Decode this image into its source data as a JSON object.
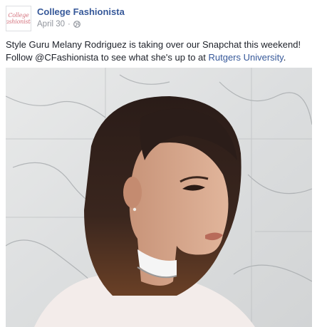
{
  "post": {
    "page_name": "College Fashionista",
    "avatar_logo_text": "College fashionista",
    "date": "April 30",
    "separator": "·",
    "privacy_icon": "globe-icon",
    "text_line1": "Style Guru Melany Rodriguez is taking over our Snapchat this weekend!",
    "text_line2_prefix": "Follow @CFashionista to see what she's up to at ",
    "text_link": "Rutgers University",
    "text_line2_suffix": ".",
    "photo_icon": "portrait-photo"
  },
  "colors": {
    "link": "#365899",
    "meta": "#90949c",
    "text": "#1d2129",
    "logo_pink": "#d5737e"
  }
}
